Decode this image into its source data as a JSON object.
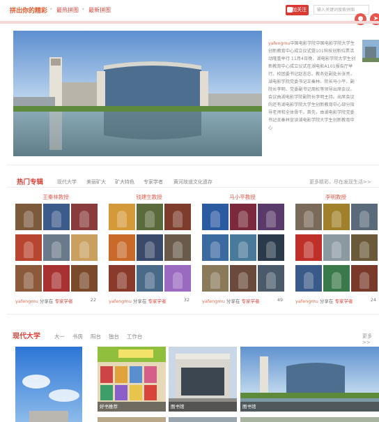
{
  "topbar": {
    "brand": "拼出你的精彩",
    "nav_items": [
      "最热拼图",
      "最新拼图"
    ],
    "follow_label": "加关注",
    "search_placeholder": "输入关键词搜索拼图"
  },
  "featured": {
    "author": "yafengmu",
    "text": "中国电影学院中国电影学院大学生创新教育中心成立仪式暨101科技创新拉票活动隆重举行 11月4日晚，湖电影学院大学生创新教育中心成立仪式在湖电影A101报告厅举行。校团委书记赵志忠、教务处副处长张亮，湖电影学院党委书记王秦林、院长马小平、副院长李明、党委副书记周松等领导出席会议。会议由湖电影学院副院长李明主持。出席会议的还有湖电影学院大学生创新教育中心部分指导老师和全体骨干。首先，由湖电影学院党委书记王秦林宣读湖电影学院大学生创新教育中心"
  },
  "hot": {
    "title": "热门专辑",
    "tags": [
      "现代大学",
      "美丽矿大",
      "矿大特色",
      "专家学者",
      "黄河故道文化遗存"
    ],
    "more": "更多精彩，尽在发现生活>>",
    "albums": [
      {
        "title": "王秦林教授",
        "user": "yafengmu",
        "shared": "分享在",
        "category": "专家学者",
        "count": "22"
      },
      {
        "title": "钱建生教授",
        "user": "yafengmu",
        "shared": "分享在",
        "category": "专家学者",
        "count": "32"
      },
      {
        "title": "马小平教授",
        "user": "yafengmu",
        "shared": "分享在",
        "category": "专家学者",
        "count": "49"
      },
      {
        "title": "李明教授",
        "user": "yafengmu",
        "shared": "分享在",
        "category": "专家学者",
        "count": "24"
      }
    ]
  },
  "modern": {
    "title": "现代大学",
    "tags": [
      "大一",
      "书房",
      "阳台",
      "独台",
      "工作台"
    ],
    "more": "更多>>",
    "pictures": [
      {
        "caption": "好书推荐"
      },
      {
        "caption": "图书馆"
      },
      {
        "caption": "图书馆"
      }
    ]
  }
}
